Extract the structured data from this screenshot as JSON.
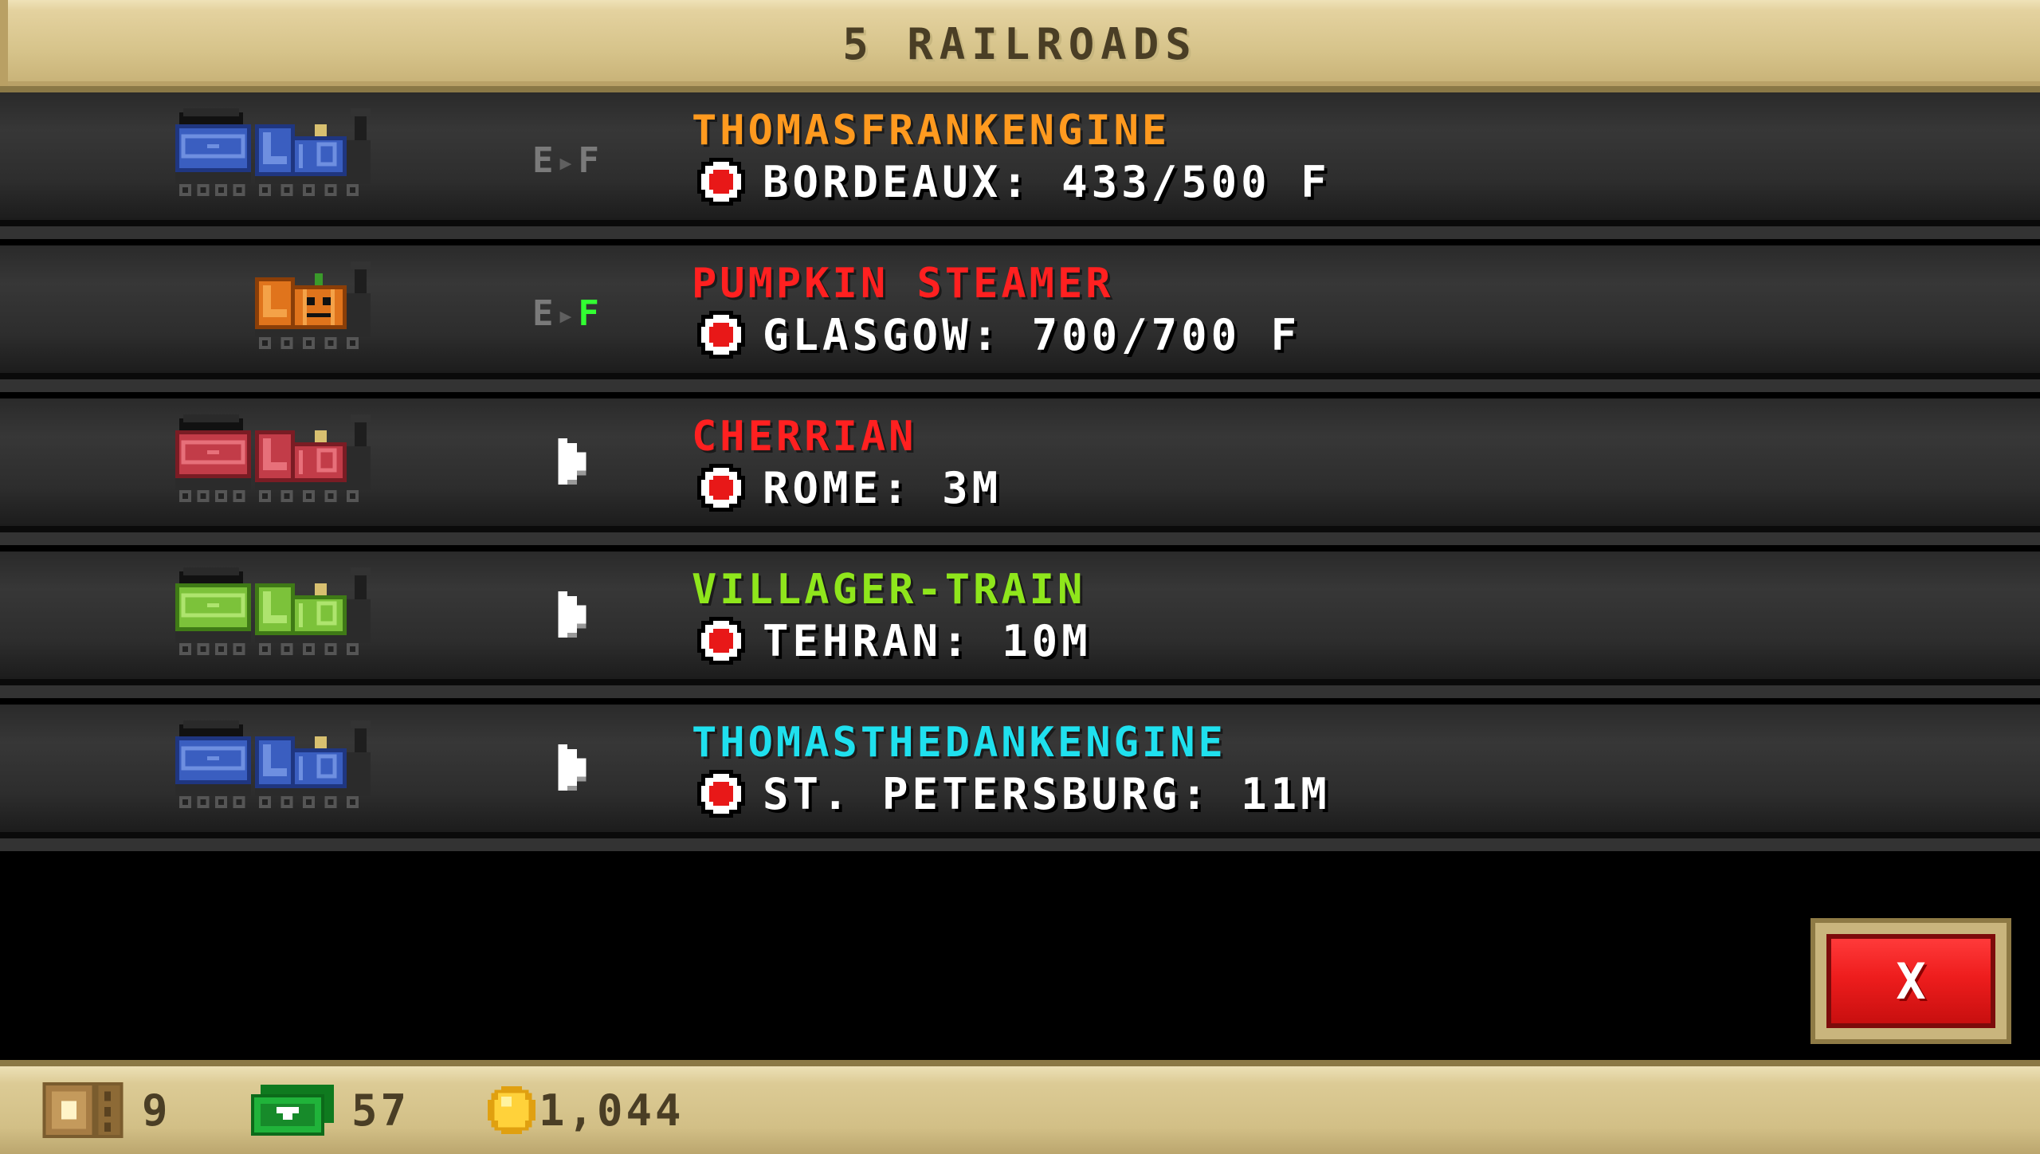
{
  "header": {
    "title": "5 RAILROADS"
  },
  "railroads": [
    {
      "name": "THOMASFRANKENGINE",
      "name_color": "#ff9a1f",
      "destination": "BORDEAUX: 433/500 F",
      "status": "fuel",
      "fuel_empty": "E",
      "fuel_full": "F",
      "fuel_full_green": false,
      "colors": {
        "body": "#3a5ec0",
        "light": "#6e8fe0",
        "dark": "#1f3680"
      }
    },
    {
      "name": "PUMPKIN STEAMER",
      "name_color": "#ff2020",
      "destination": "GLASGOW: 700/700 F",
      "status": "fuel",
      "fuel_empty": "E",
      "fuel_full": "F",
      "fuel_full_green": true,
      "colors": {
        "body": "#e0741c",
        "light": "#f4a248",
        "dark": "#8a3e08"
      }
    },
    {
      "name": "CHERRIAN",
      "name_color": "#ff2020",
      "destination": "ROME: 3M",
      "status": "play",
      "colors": {
        "body": "#c23c48",
        "light": "#e7707a",
        "dark": "#7a1c24"
      }
    },
    {
      "name": "VILLAGER-TRAIN",
      "name_color": "#8fe61c",
      "destination": "TEHRAN: 10M",
      "status": "play",
      "colors": {
        "body": "#7cc23a",
        "light": "#aee46e",
        "dark": "#3f7a16"
      }
    },
    {
      "name": "THOMASTHEDANKENGINE",
      "name_color": "#1fe0ee",
      "destination": "ST. PETERSBURG: 11M",
      "status": "play",
      "colors": {
        "body": "#3a5ec0",
        "light": "#6e8fe0",
        "dark": "#1f3680"
      }
    }
  ],
  "close_button": {
    "label": "X"
  },
  "footer": {
    "tickets": "9",
    "bucks": "57",
    "coins": "1,044"
  }
}
